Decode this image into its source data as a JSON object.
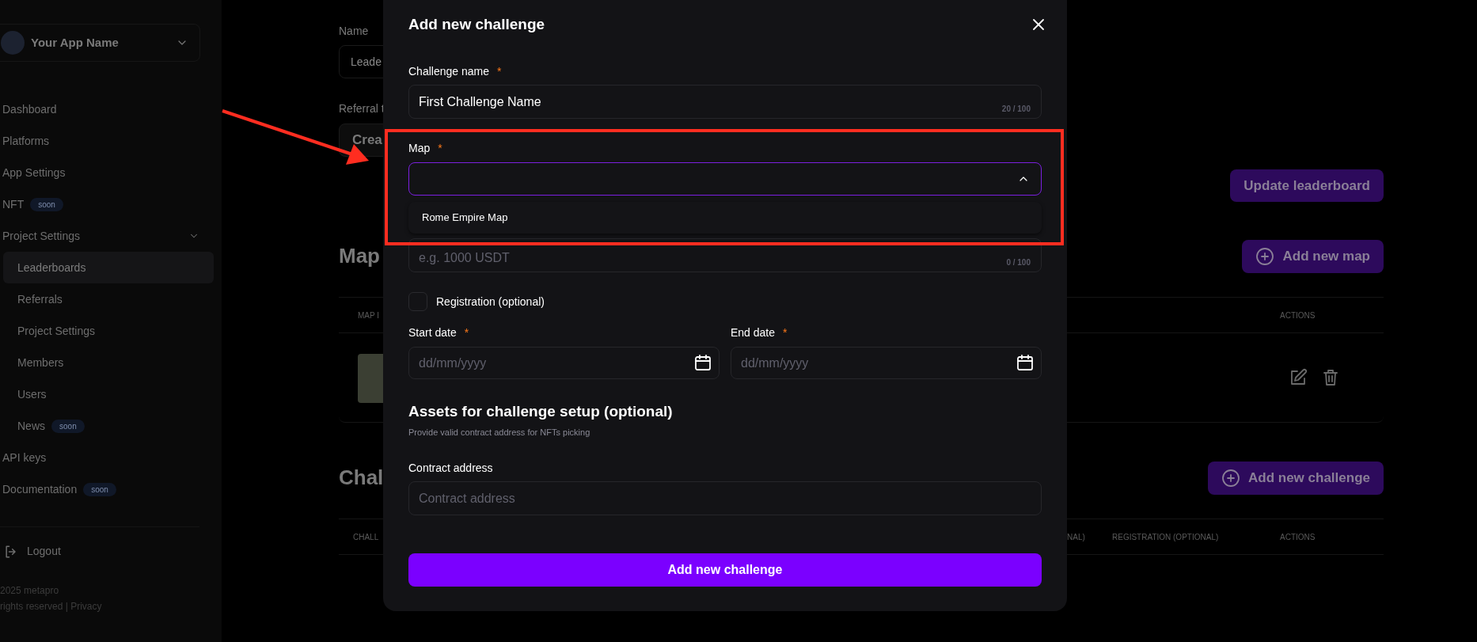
{
  "sidebar": {
    "app_name": "Your App Name",
    "nav": [
      {
        "label": "Dashboard",
        "selected": false
      },
      {
        "label": "Platforms",
        "selected": false
      },
      {
        "label": "App Settings",
        "selected": false
      },
      {
        "label": "NFT",
        "selected": false,
        "badge": "soon"
      },
      {
        "label": "Project Settings",
        "selected": false,
        "expanded": true,
        "children": [
          {
            "label": "Leaderboards",
            "selected": true
          },
          {
            "label": "Referrals",
            "selected": false
          },
          {
            "label": "Project Settings",
            "selected": false
          },
          {
            "label": "Members",
            "selected": false
          },
          {
            "label": "Users",
            "selected": false
          },
          {
            "label": "News",
            "selected": false,
            "badge": "soon"
          }
        ]
      },
      {
        "label": "API keys",
        "selected": false
      },
      {
        "label": "Documentation",
        "selected": false,
        "badge": "soon"
      }
    ],
    "logout": "Logout",
    "footer": [
      "2025 metapro",
      "rights reserved | Privacy"
    ]
  },
  "page": {
    "name_label": "Name",
    "name_value": "Leade",
    "referral_label": "Referral t",
    "referral_button": "Crea",
    "update_button": "Update leaderboard",
    "maps_heading": "Map",
    "add_map_button": "Add new map",
    "maps_table": {
      "columns": [
        "MAP I",
        "ACTIONS"
      ]
    },
    "challenges_heading": "Chal",
    "add_challenge_button": "Add new challenge",
    "challenges_table": {
      "columns": [
        "CHALL",
        "NAL)",
        "REGISTRATION (OPTIONAL)",
        "ACTIONS"
      ]
    }
  },
  "modal": {
    "title": "Add new challenge",
    "required_mark": "*",
    "fields": [
      {
        "kind": "text",
        "label": "Challenge name",
        "required": true,
        "value": "First Challenge Name",
        "counter": "20 / 100"
      },
      {
        "kind": "select",
        "label": "Map",
        "required": true,
        "expanded": true,
        "options": [
          {
            "label": "Rome Empire Map",
            "selected": false
          }
        ]
      },
      {
        "kind": "text",
        "placeholder": "e.g. 1000 USDT",
        "counter": "0 / 100"
      },
      {
        "kind": "checkbox",
        "label": "Registration (optional)",
        "checked": false
      },
      {
        "kind": "dates",
        "items": [
          {
            "label": "Start date",
            "required": true,
            "placeholder": "dd/mm/yyyy"
          },
          {
            "label": "End date",
            "required": true,
            "placeholder": "dd/mm/yyyy"
          }
        ]
      },
      {
        "kind": "section",
        "heading": "Assets for challenge setup (optional)",
        "description": "Provide valid contract address for NFTs picking"
      },
      {
        "kind": "text",
        "label": "Contract address",
        "required": false,
        "placeholder": "Contract address"
      }
    ],
    "submit": "Add new challenge"
  }
}
